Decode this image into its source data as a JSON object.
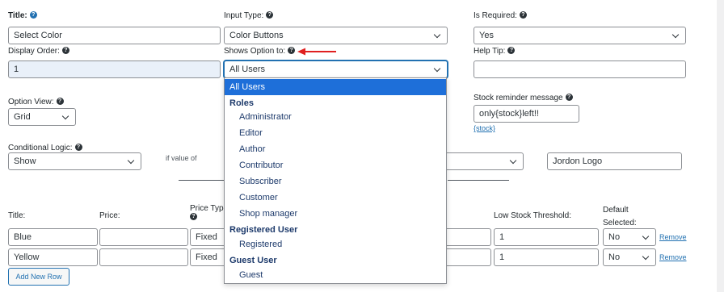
{
  "top": {
    "title": {
      "label": "Title:",
      "value": "Select Color"
    },
    "input_type": {
      "label": "Input Type:",
      "value": "Color Buttons"
    },
    "is_required": {
      "label": "Is Required:",
      "value": "Yes"
    },
    "display_order": {
      "label": "Display Order:",
      "value": "1"
    },
    "shows_option_to": {
      "label": "Shows Option to:",
      "value": "All Users"
    },
    "help_tip": {
      "label": "Help Tip:",
      "value": ""
    },
    "option_view": {
      "label": "Option View:",
      "value": "Grid"
    },
    "stock_reminder": {
      "label": "Stock reminder message",
      "value": "only{stock}left!!",
      "hint": "{stock}"
    },
    "conditional_logic": {
      "label": "Conditional Logic:",
      "value": "Show",
      "if_value_of": "if value of",
      "target_value": "Jordon Logo"
    }
  },
  "dropdown": {
    "selected": "All Users",
    "groups": [
      {
        "label": "Roles",
        "items": [
          "Administrator",
          "Editor",
          "Author",
          "Contributor",
          "Subscriber",
          "Customer",
          "Shop manager"
        ]
      },
      {
        "label": "Registered User",
        "items": [
          "Registered"
        ]
      },
      {
        "label": "Guest User",
        "items": [
          "Guest"
        ]
      }
    ]
  },
  "options_table": {
    "headers": {
      "title": "Title:",
      "price": "Price:",
      "price_type": "Price Type",
      "low_stock": "Low Stock Threshold:",
      "default_selected": "Default Selected:"
    },
    "rows": [
      {
        "title": "Blue",
        "price": "",
        "price_type": "Fixed",
        "low_stock": "1",
        "default": "No",
        "remove": "Remove"
      },
      {
        "title": "Yellow",
        "price": "",
        "price_type": "Fixed",
        "low_stock": "1",
        "default": "No",
        "remove": "Remove"
      }
    ],
    "add_row_label": "Add New Row"
  },
  "colors": {
    "accent": "#2271b1",
    "arrow": "#e02020",
    "highlight": "#1e6fd9"
  }
}
